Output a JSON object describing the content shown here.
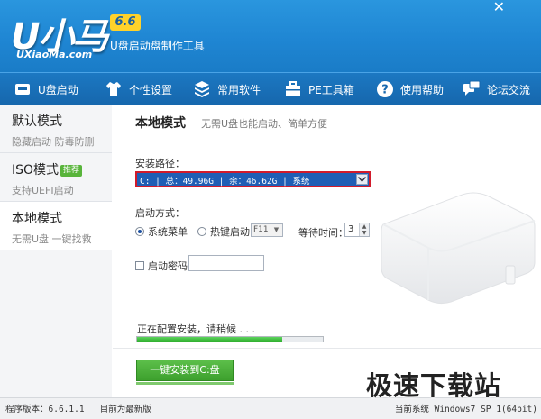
{
  "app": {
    "logo_text": "U小马",
    "logo_sub": "UXiaoMa.com",
    "version_badge": "6.6",
    "tagline": "U盘启动盘制作工具",
    "close_label": "✕"
  },
  "toolbar": {
    "items": [
      {
        "label": "U盘启动",
        "icon": "usb-drive-icon"
      },
      {
        "label": "个性设置",
        "icon": "shirt-icon"
      },
      {
        "label": "常用软件",
        "icon": "software-icon"
      },
      {
        "label": "PE工具箱",
        "icon": "toolbox-icon"
      },
      {
        "label": "使用帮助",
        "icon": "help-icon"
      },
      {
        "label": "论坛交流",
        "icon": "chat-icon"
      }
    ]
  },
  "sidebar": {
    "items": [
      {
        "title": "默认模式",
        "subtitle": "隐藏启动 防毒防删"
      },
      {
        "title": "ISO模式",
        "badge": "推荐",
        "subtitle": "支持UEFI启动"
      },
      {
        "title": "本地模式",
        "subtitle": "无需U盘 一键找救"
      }
    ],
    "active_index": 2
  },
  "main": {
    "title": "本地模式",
    "subtitle": "无需U盘也能启动、简单方便",
    "install_path_label": "安装路径：",
    "install_path_value": "C: | 总：49.96G | 余：46.62G | 系统",
    "boot_mode_label": "启动方式：",
    "boot_options": [
      {
        "label": "系统菜单",
        "selected": true
      },
      {
        "label": "热键启动",
        "selected": false
      }
    ],
    "hotkey_value": "F11",
    "wait_label": "等待时间：",
    "wait_value": "3",
    "password_label": "启动密码",
    "password_checked": false,
    "password_value": "",
    "status_text": "正在配置安装，请稍候 . . .",
    "progress_fraction": 0.78,
    "install_button": "一键安装到C:盘"
  },
  "footer": {
    "version_label": "程序版本：",
    "version_value": "6.6.1.1",
    "update_status": "目前为最新版",
    "system_label": "当前系统",
    "system_value": "Windows7 SP 1(64bit)"
  },
  "watermark": "极速下载站",
  "colors": {
    "header_blue": "#1f86d3",
    "toolbar_blue": "#1667ad",
    "select_blue": "#1f5eb5",
    "highlight_red": "#d21b2b",
    "accent_green": "#3da02d",
    "version_yellow": "#ffd22b"
  }
}
